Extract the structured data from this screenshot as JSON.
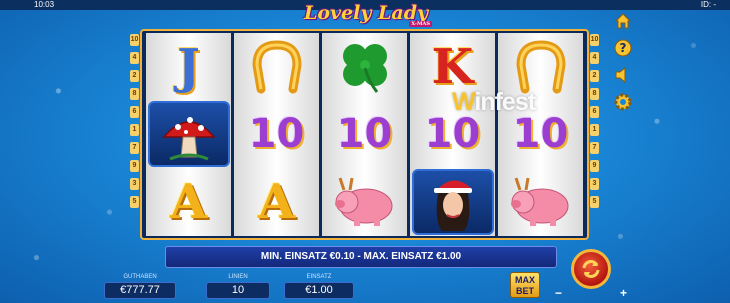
{
  "topbar": {
    "time": "10:03",
    "id_label": "ID: -"
  },
  "logo": {
    "title": "Lovely Lady",
    "subtitle": "X-MAS"
  },
  "reels": [
    [
      "J",
      "horseshoe",
      "A"
    ],
    [
      "mushroom",
      "10",
      "A"
    ],
    [
      "clover",
      "10",
      "pig"
    ],
    [
      "K",
      "10",
      "lady"
    ],
    [
      "horseshoe",
      "10",
      "pig"
    ]
  ],
  "paylines_left": [
    "10",
    "4",
    "2",
    "8",
    "6",
    "1",
    "7",
    "9",
    "3",
    "5"
  ],
  "paylines_right": [
    "10",
    "4",
    "2",
    "8",
    "6",
    "1",
    "7",
    "9",
    "3",
    "5"
  ],
  "info_text": "MIN. EINSATZ €0.10 - MAX. EINSATZ €1.00",
  "bottom": {
    "balance_label": "GUTHABEN",
    "balance_value": "€777.77",
    "lines_label": "LINIEN",
    "lines_value": "10",
    "bet_label": "EINSATZ",
    "bet_value": "€1.00",
    "maxbet_line1": "MAX",
    "maxbet_line2": "BET",
    "minus": "−",
    "plus": "+"
  },
  "watermark": {
    "prefix": "W",
    "text": "infest"
  },
  "colors": {
    "frame": "#f2b13a",
    "panel": "#0c2c62",
    "spin": "#c21d12"
  },
  "icons": [
    "home-icon",
    "help-icon",
    "sound-icon",
    "settings-icon",
    "spin-icon"
  ]
}
